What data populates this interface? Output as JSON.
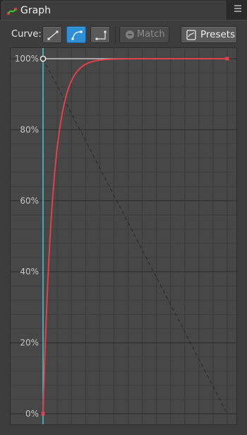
{
  "tab": {
    "title": "Graph",
    "icon": "graph-icon",
    "menu_icon": "hamburger-menu-icon"
  },
  "toolbar": {
    "curve_label": "Curve:",
    "curve_buttons": [
      {
        "name": "linear",
        "icon": "linear-curve-icon",
        "active": false
      },
      {
        "name": "ease-out",
        "icon": "ease-curve-icon",
        "active": true
      },
      {
        "name": "step",
        "icon": "step-curve-icon",
        "active": false
      }
    ],
    "match_label": "Match",
    "match_enabled": false,
    "presets_label": "Presets"
  },
  "graph": {
    "y_ticks": [
      "100%",
      "80%",
      "60%",
      "40%",
      "20%",
      "0%"
    ],
    "curve_color": "#e0414a",
    "handle_color": "#d8d8d8",
    "cursor_color": "#4ad2d6"
  },
  "colors": {
    "accent": "#2f8fd6",
    "background": "#3d3d3d"
  }
}
